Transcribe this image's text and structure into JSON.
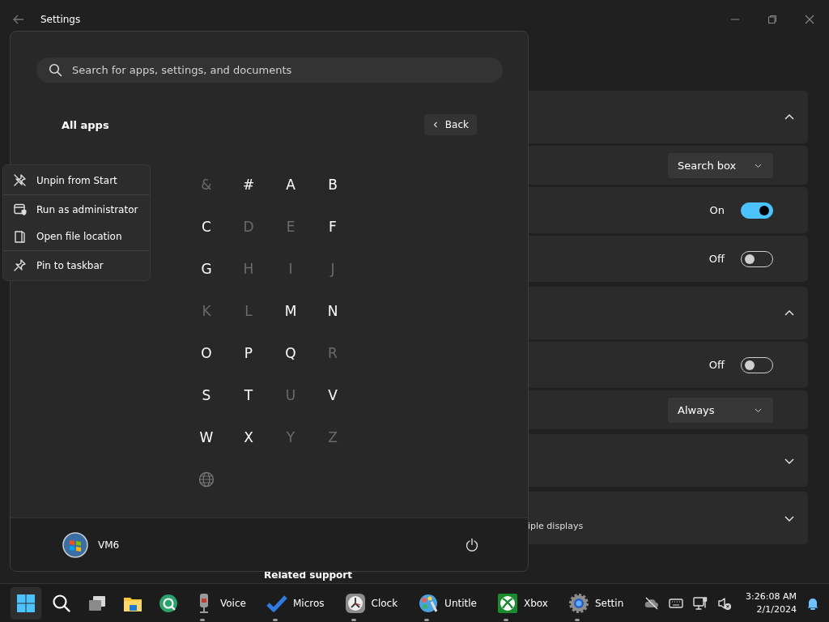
{
  "window": {
    "title": "Settings"
  },
  "settings": {
    "groups": [
      {
        "expanded": true,
        "rows": [
          {
            "kind": "dropdown",
            "value": "Search box"
          },
          {
            "kind": "toggle",
            "on": true,
            "label": "On"
          },
          {
            "kind": "toggle",
            "on": false,
            "label": "Off"
          }
        ]
      },
      {
        "expanded": true,
        "rows": [
          {
            "kind": "toggle",
            "on": false,
            "label": "Off"
          },
          {
            "kind": "dropdown",
            "value": "Always"
          }
        ]
      },
      {
        "expanded": false
      },
      {
        "expanded": false,
        "subtitle": "iple displays"
      }
    ],
    "section_heading": "Related support"
  },
  "start_menu": {
    "search": {
      "placeholder": "Search for apps, settings, and documents"
    },
    "heading": "All apps",
    "back_button": "Back",
    "letters": [
      {
        "kind": "letter",
        "label": "&",
        "disabled": true
      },
      {
        "kind": "letter",
        "label": "#",
        "disabled": false
      },
      {
        "kind": "letter",
        "label": "A",
        "disabled": false
      },
      {
        "kind": "letter",
        "label": "B",
        "disabled": false
      },
      {
        "kind": "letter",
        "label": "C",
        "disabled": false
      },
      {
        "kind": "letter",
        "label": "D",
        "disabled": true
      },
      {
        "kind": "letter",
        "label": "E",
        "disabled": true
      },
      {
        "kind": "letter",
        "label": "F",
        "disabled": false
      },
      {
        "kind": "letter",
        "label": "G",
        "disabled": false
      },
      {
        "kind": "letter",
        "label": "H",
        "disabled": true
      },
      {
        "kind": "letter",
        "label": "I",
        "disabled": true
      },
      {
        "kind": "letter",
        "label": "J",
        "disabled": true
      },
      {
        "kind": "letter",
        "label": "K",
        "disabled": true
      },
      {
        "kind": "letter",
        "label": "L",
        "disabled": true
      },
      {
        "kind": "letter",
        "label": "M",
        "disabled": false
      },
      {
        "kind": "letter",
        "label": "N",
        "disabled": false
      },
      {
        "kind": "letter",
        "label": "O",
        "disabled": false
      },
      {
        "kind": "letter",
        "label": "P",
        "disabled": false
      },
      {
        "kind": "letter",
        "label": "Q",
        "disabled": false
      },
      {
        "kind": "letter",
        "label": "R",
        "disabled": true
      },
      {
        "kind": "letter",
        "label": "S",
        "disabled": false
      },
      {
        "kind": "letter",
        "label": "T",
        "disabled": false
      },
      {
        "kind": "letter",
        "label": "U",
        "disabled": true
      },
      {
        "kind": "letter",
        "label": "V",
        "disabled": false
      },
      {
        "kind": "letter",
        "label": "W",
        "disabled": false
      },
      {
        "kind": "letter",
        "label": "X",
        "disabled": false
      },
      {
        "kind": "letter",
        "label": "Y",
        "disabled": true
      },
      {
        "kind": "letter",
        "label": "Z",
        "disabled": true
      },
      {
        "kind": "globe",
        "disabled": true
      }
    ],
    "user": {
      "name": "VM6"
    }
  },
  "context_menu": {
    "items": [
      {
        "kind": "unpin",
        "label": "Unpin from Start",
        "separator_after": true
      },
      {
        "kind": "admin",
        "label": "Run as administrator",
        "separator_after": false
      },
      {
        "kind": "folder",
        "label": "Open file location",
        "separator_after": true
      },
      {
        "kind": "pin",
        "label": "Pin to taskbar",
        "separator_after": false
      }
    ]
  },
  "taskbar": {
    "items": [
      {
        "kind": "start",
        "active": true,
        "running": false
      },
      {
        "kind": "search",
        "active": false,
        "running": false
      },
      {
        "kind": "taskview",
        "active": false,
        "running": false
      },
      {
        "kind": "explorer",
        "active": false,
        "running": false
      },
      {
        "kind": "ring",
        "active": false,
        "running": false
      },
      {
        "kind": "mic",
        "label": "Voice",
        "active": false,
        "running": true
      },
      {
        "kind": "check",
        "label": "Micros",
        "active": false,
        "running": true
      },
      {
        "kind": "clock",
        "label": "Clock",
        "active": false,
        "running": true
      },
      {
        "kind": "paint",
        "label": "Untitle",
        "active": false,
        "running": true
      },
      {
        "kind": "xbox",
        "label": "Xbox",
        "active": false,
        "running": true
      },
      {
        "kind": "gear",
        "label": "Settin",
        "active": false,
        "running": true
      }
    ],
    "tray": {
      "time": "3:26:08 AM",
      "date": "2/1/2024"
    }
  }
}
